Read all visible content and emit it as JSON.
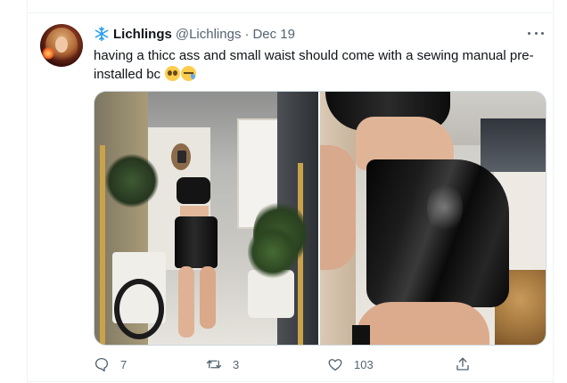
{
  "tweet": {
    "display_name": "Lichlings",
    "handle": "@Lichlings",
    "separator": "·",
    "date": "Dec 19",
    "text": "having a thicc ass and small waist should come with a sewing manual pre-installed bc",
    "emojis": [
      "pleading-face",
      "sleepy-face"
    ]
  },
  "actions": {
    "reply_count": "7",
    "retweet_count": "3",
    "like_count": "103"
  },
  "icons": {
    "name_badge": "snowflake-icon",
    "more": "more-icon",
    "reply": "reply-icon",
    "retweet": "retweet-icon",
    "like": "heart-icon",
    "share": "share-icon"
  },
  "colors": {
    "text_primary": "#0f1419",
    "text_secondary": "#536471",
    "snowflake": "#1d9bf0",
    "border": "#cfd9de"
  }
}
